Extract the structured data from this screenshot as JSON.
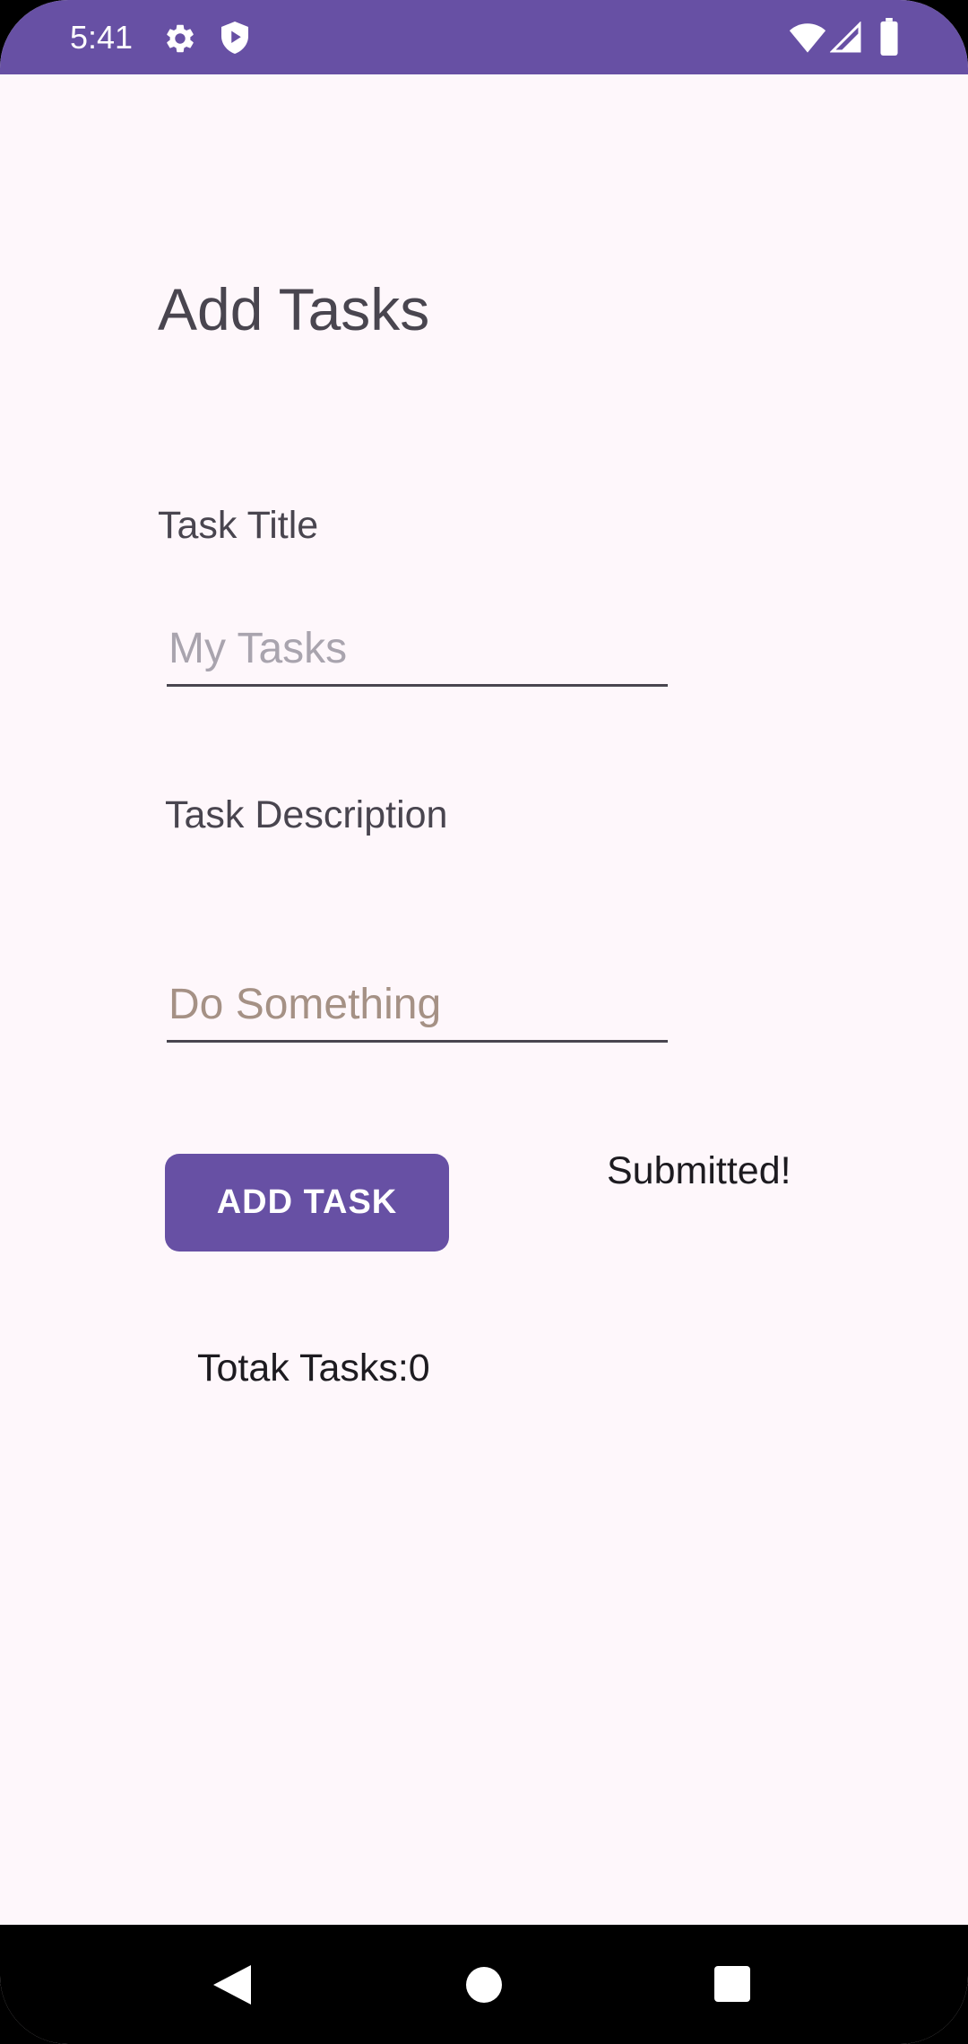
{
  "status_bar": {
    "time": "5:41",
    "background": "#6750A4",
    "icons": [
      "gear-icon",
      "shield-play-icon",
      "wifi-icon",
      "cellular-signal-icon",
      "battery-icon"
    ]
  },
  "main": {
    "title": "Add Tasks",
    "task_title_label": "Task Title",
    "task_title_placeholder": "My Tasks",
    "task_title_value": "",
    "task_description_label": "Task Description",
    "task_description_placeholder": "Do Something",
    "task_description_value": "",
    "add_button_label": "ADD TASK",
    "status_message": "Submitted!",
    "total_tasks": "Totak Tasks:0"
  },
  "colors": {
    "accent": "#6750A4",
    "background": "#FEF7FB",
    "text": "#49454F"
  },
  "nav_bar": {
    "icons": [
      "back-icon",
      "home-icon",
      "recents-icon"
    ]
  }
}
